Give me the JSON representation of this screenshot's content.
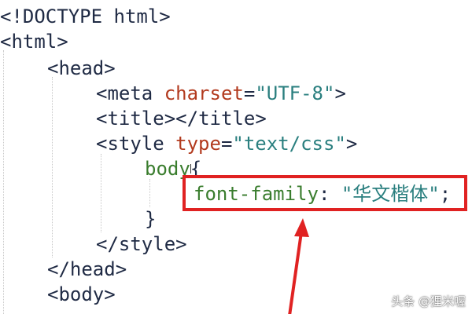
{
  "editor": {
    "lines": [
      {
        "parts": [
          {
            "cls": "t-bracket",
            "text": "<"
          },
          {
            "cls": "t-tag",
            "text": "!DOCTYPE html"
          },
          {
            "cls": "t-bracket",
            "text": ">"
          }
        ]
      },
      {
        "parts": [
          {
            "cls": "t-bracket",
            "text": "<"
          },
          {
            "cls": "t-tag",
            "text": "html"
          },
          {
            "cls": "t-bracket",
            "text": ">"
          }
        ]
      },
      {
        "parts": [
          {
            "cls": "t-bracket",
            "text": "<"
          },
          {
            "cls": "t-tag",
            "text": "head"
          },
          {
            "cls": "t-bracket",
            "text": ">"
          }
        ]
      },
      {
        "parts": [
          {
            "cls": "t-bracket",
            "text": "<"
          },
          {
            "cls": "t-tag",
            "text": "meta "
          },
          {
            "cls": "t-attr",
            "text": "charset"
          },
          {
            "cls": "t-eq",
            "text": "="
          },
          {
            "cls": "t-str",
            "text": "\"UTF-8\""
          },
          {
            "cls": "t-bracket",
            "text": ">"
          }
        ]
      },
      {
        "parts": [
          {
            "cls": "t-bracket",
            "text": "<"
          },
          {
            "cls": "t-tag",
            "text": "title"
          },
          {
            "cls": "t-bracket",
            "text": "></"
          },
          {
            "cls": "t-tag",
            "text": "title"
          },
          {
            "cls": "t-bracket",
            "text": ">"
          }
        ]
      },
      {
        "parts": [
          {
            "cls": "t-bracket",
            "text": "<"
          },
          {
            "cls": "t-tag",
            "text": "style "
          },
          {
            "cls": "t-attr",
            "text": "type"
          },
          {
            "cls": "t-eq",
            "text": "="
          },
          {
            "cls": "t-str",
            "text": "\"text/css\""
          },
          {
            "cls": "t-bracket",
            "text": ">"
          }
        ]
      },
      {
        "parts": [
          {
            "cls": "t-sel",
            "text": "body"
          },
          {
            "cls": "t-punc",
            "text": "{"
          }
        ]
      },
      {
        "parts": [
          {
            "cls": "t-prop",
            "text": "font-family"
          },
          {
            "cls": "t-punc",
            "text": ": "
          },
          {
            "cls": "t-val",
            "text": "\"华文楷体\""
          },
          {
            "cls": "t-punc",
            "text": ";"
          }
        ]
      },
      {
        "parts": [
          {
            "cls": "t-punc",
            "text": "}"
          }
        ]
      },
      {
        "parts": [
          {
            "cls": "t-bracket",
            "text": "</"
          },
          {
            "cls": "t-tag",
            "text": "style"
          },
          {
            "cls": "t-bracket",
            "text": ">"
          }
        ]
      },
      {
        "parts": [
          {
            "cls": "t-bracket",
            "text": "</"
          },
          {
            "cls": "t-tag",
            "text": "head"
          },
          {
            "cls": "t-bracket",
            "text": ">"
          }
        ]
      },
      {
        "parts": [
          {
            "cls": "t-bracket",
            "text": "<"
          },
          {
            "cls": "t-tag",
            "text": "body"
          },
          {
            "cls": "t-bracket",
            "text": ">"
          }
        ]
      }
    ]
  },
  "annotation": {
    "highlight_color": "#e02222"
  },
  "watermark": {
    "text": "头条 @狸米喔"
  }
}
